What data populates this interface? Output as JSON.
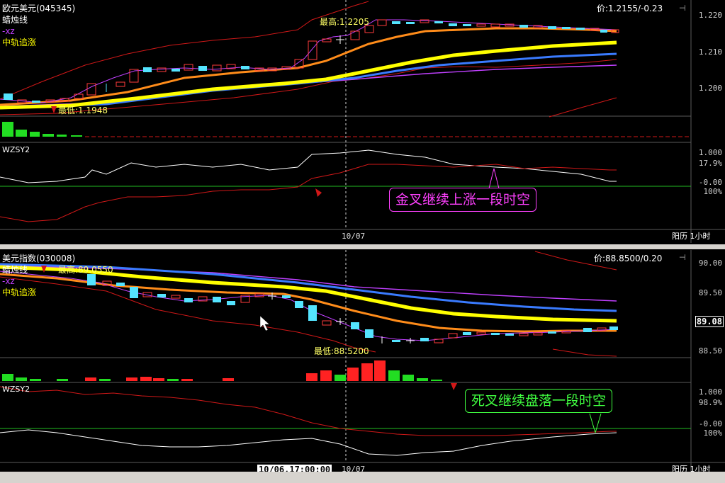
{
  "top": {
    "title": "欧元美元",
    "code": "(045345)",
    "price_readout": "价:1.2155/-0.23",
    "legend": [
      "蜡烛线",
      "-xz",
      "中轨追涨"
    ],
    "high_label": "最高:1.2205",
    "low_label": "最低:1.1948",
    "y_ticks": [
      "1.220",
      "1.210",
      "1.200"
    ],
    "indicator_name": "WZSY2",
    "ind_ticks": [
      "1.000",
      "17.9%",
      "-0.00",
      "100%"
    ],
    "callout": "金叉继续上涨一段时空",
    "date_tick": "10/07",
    "period": "阳历 1小时"
  },
  "bottom": {
    "title": "美元指数",
    "code": "(030008)",
    "price_readout": "价:88.8500/0.20",
    "legend": [
      "蜡烛线",
      "-xz",
      "中轨追涨"
    ],
    "high_label": "最高:89.0550",
    "low_label": "最低:88.5200",
    "y_ticks": [
      "90.00",
      "89.50",
      "88.50"
    ],
    "current_price": "89.08",
    "indicator_name": "WZSY2",
    "ind_ticks": [
      "1.000",
      "98.9%",
      "-0.00",
      "100%"
    ],
    "callout": "死叉继续盘落一段时空",
    "time_box": "10/06.17:00:00",
    "date_tick": "10/07",
    "period": "阳历 1小时"
  },
  "colors": {
    "up": "#ff3b3b",
    "down": "#54e4ff",
    "ma_yellow": "#ffff00",
    "ma_orange": "#ff8c1a",
    "ma_blue": "#3a7bff",
    "ma_purple": "#c040ff",
    "band_red": "#d01818",
    "vol_green": "#22dd22",
    "callout_top": "#ff40ff",
    "callout_bottom": "#40ff40"
  }
}
